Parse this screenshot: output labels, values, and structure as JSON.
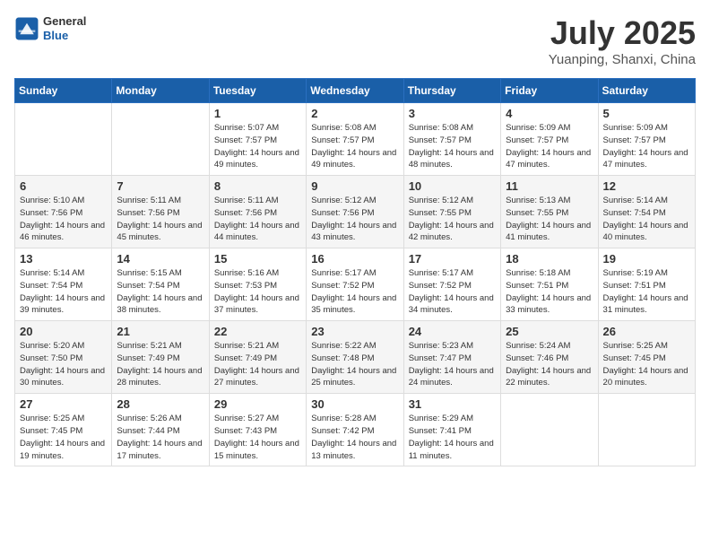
{
  "header": {
    "logo": {
      "general": "General",
      "blue": "Blue"
    },
    "title": "July 2025",
    "location": "Yuanping, Shanxi, China"
  },
  "weekdays": [
    "Sunday",
    "Monday",
    "Tuesday",
    "Wednesday",
    "Thursday",
    "Friday",
    "Saturday"
  ],
  "weeks": [
    [
      null,
      null,
      {
        "day": "1",
        "sunrise": "Sunrise: 5:07 AM",
        "sunset": "Sunset: 7:57 PM",
        "daylight": "Daylight: 14 hours and 49 minutes."
      },
      {
        "day": "2",
        "sunrise": "Sunrise: 5:08 AM",
        "sunset": "Sunset: 7:57 PM",
        "daylight": "Daylight: 14 hours and 49 minutes."
      },
      {
        "day": "3",
        "sunrise": "Sunrise: 5:08 AM",
        "sunset": "Sunset: 7:57 PM",
        "daylight": "Daylight: 14 hours and 48 minutes."
      },
      {
        "day": "4",
        "sunrise": "Sunrise: 5:09 AM",
        "sunset": "Sunset: 7:57 PM",
        "daylight": "Daylight: 14 hours and 47 minutes."
      },
      {
        "day": "5",
        "sunrise": "Sunrise: 5:09 AM",
        "sunset": "Sunset: 7:57 PM",
        "daylight": "Daylight: 14 hours and 47 minutes."
      }
    ],
    [
      {
        "day": "6",
        "sunrise": "Sunrise: 5:10 AM",
        "sunset": "Sunset: 7:56 PM",
        "daylight": "Daylight: 14 hours and 46 minutes."
      },
      {
        "day": "7",
        "sunrise": "Sunrise: 5:11 AM",
        "sunset": "Sunset: 7:56 PM",
        "daylight": "Daylight: 14 hours and 45 minutes."
      },
      {
        "day": "8",
        "sunrise": "Sunrise: 5:11 AM",
        "sunset": "Sunset: 7:56 PM",
        "daylight": "Daylight: 14 hours and 44 minutes."
      },
      {
        "day": "9",
        "sunrise": "Sunrise: 5:12 AM",
        "sunset": "Sunset: 7:56 PM",
        "daylight": "Daylight: 14 hours and 43 minutes."
      },
      {
        "day": "10",
        "sunrise": "Sunrise: 5:12 AM",
        "sunset": "Sunset: 7:55 PM",
        "daylight": "Daylight: 14 hours and 42 minutes."
      },
      {
        "day": "11",
        "sunrise": "Sunrise: 5:13 AM",
        "sunset": "Sunset: 7:55 PM",
        "daylight": "Daylight: 14 hours and 41 minutes."
      },
      {
        "day": "12",
        "sunrise": "Sunrise: 5:14 AM",
        "sunset": "Sunset: 7:54 PM",
        "daylight": "Daylight: 14 hours and 40 minutes."
      }
    ],
    [
      {
        "day": "13",
        "sunrise": "Sunrise: 5:14 AM",
        "sunset": "Sunset: 7:54 PM",
        "daylight": "Daylight: 14 hours and 39 minutes."
      },
      {
        "day": "14",
        "sunrise": "Sunrise: 5:15 AM",
        "sunset": "Sunset: 7:54 PM",
        "daylight": "Daylight: 14 hours and 38 minutes."
      },
      {
        "day": "15",
        "sunrise": "Sunrise: 5:16 AM",
        "sunset": "Sunset: 7:53 PM",
        "daylight": "Daylight: 14 hours and 37 minutes."
      },
      {
        "day": "16",
        "sunrise": "Sunrise: 5:17 AM",
        "sunset": "Sunset: 7:52 PM",
        "daylight": "Daylight: 14 hours and 35 minutes."
      },
      {
        "day": "17",
        "sunrise": "Sunrise: 5:17 AM",
        "sunset": "Sunset: 7:52 PM",
        "daylight": "Daylight: 14 hours and 34 minutes."
      },
      {
        "day": "18",
        "sunrise": "Sunrise: 5:18 AM",
        "sunset": "Sunset: 7:51 PM",
        "daylight": "Daylight: 14 hours and 33 minutes."
      },
      {
        "day": "19",
        "sunrise": "Sunrise: 5:19 AM",
        "sunset": "Sunset: 7:51 PM",
        "daylight": "Daylight: 14 hours and 31 minutes."
      }
    ],
    [
      {
        "day": "20",
        "sunrise": "Sunrise: 5:20 AM",
        "sunset": "Sunset: 7:50 PM",
        "daylight": "Daylight: 14 hours and 30 minutes."
      },
      {
        "day": "21",
        "sunrise": "Sunrise: 5:21 AM",
        "sunset": "Sunset: 7:49 PM",
        "daylight": "Daylight: 14 hours and 28 minutes."
      },
      {
        "day": "22",
        "sunrise": "Sunrise: 5:21 AM",
        "sunset": "Sunset: 7:49 PM",
        "daylight": "Daylight: 14 hours and 27 minutes."
      },
      {
        "day": "23",
        "sunrise": "Sunrise: 5:22 AM",
        "sunset": "Sunset: 7:48 PM",
        "daylight": "Daylight: 14 hours and 25 minutes."
      },
      {
        "day": "24",
        "sunrise": "Sunrise: 5:23 AM",
        "sunset": "Sunset: 7:47 PM",
        "daylight": "Daylight: 14 hours and 24 minutes."
      },
      {
        "day": "25",
        "sunrise": "Sunrise: 5:24 AM",
        "sunset": "Sunset: 7:46 PM",
        "daylight": "Daylight: 14 hours and 22 minutes."
      },
      {
        "day": "26",
        "sunrise": "Sunrise: 5:25 AM",
        "sunset": "Sunset: 7:45 PM",
        "daylight": "Daylight: 14 hours and 20 minutes."
      }
    ],
    [
      {
        "day": "27",
        "sunrise": "Sunrise: 5:25 AM",
        "sunset": "Sunset: 7:45 PM",
        "daylight": "Daylight: 14 hours and 19 minutes."
      },
      {
        "day": "28",
        "sunrise": "Sunrise: 5:26 AM",
        "sunset": "Sunset: 7:44 PM",
        "daylight": "Daylight: 14 hours and 17 minutes."
      },
      {
        "day": "29",
        "sunrise": "Sunrise: 5:27 AM",
        "sunset": "Sunset: 7:43 PM",
        "daylight": "Daylight: 14 hours and 15 minutes."
      },
      {
        "day": "30",
        "sunrise": "Sunrise: 5:28 AM",
        "sunset": "Sunset: 7:42 PM",
        "daylight": "Daylight: 14 hours and 13 minutes."
      },
      {
        "day": "31",
        "sunrise": "Sunrise: 5:29 AM",
        "sunset": "Sunset: 7:41 PM",
        "daylight": "Daylight: 14 hours and 11 minutes."
      },
      null,
      null
    ]
  ]
}
